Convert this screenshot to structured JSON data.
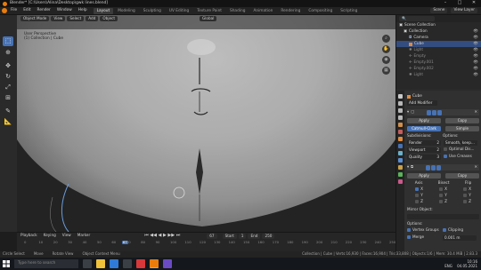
{
  "window": {
    "title": "Blender* [C:\\Users\\Alina\\Desktop\\gwk lines.blend]"
  },
  "menu": {
    "items": [
      "File",
      "Edit",
      "Render",
      "Window",
      "Help"
    ],
    "tabs": [
      "Layout",
      "Modeling",
      "Sculpting",
      "UV Editing",
      "Texture Paint",
      "Shading",
      "Animation",
      "Rendering",
      "Compositing",
      "Scripting"
    ],
    "active_tab": "Layout",
    "scene": "Scene",
    "view_layer": "View Layer"
  },
  "viewport": {
    "mode": "Object Mode",
    "menus": [
      "View",
      "Select",
      "Add",
      "Object"
    ],
    "transform": "Global",
    "info_line1": "User Perspective",
    "info_line2": "(1) Collection | Cube"
  },
  "timeline": {
    "menus": [
      "Playback",
      "Keying",
      "View",
      "Marker"
    ],
    "current_frame": "67",
    "start_label": "Start",
    "start": "1",
    "end_label": "End",
    "end": "250",
    "ticks": [
      "0",
      "10",
      "20",
      "30",
      "40",
      "50",
      "60",
      "70",
      "80",
      "90",
      "100",
      "110",
      "120",
      "130",
      "140",
      "150",
      "160",
      "170",
      "180",
      "190",
      "200",
      "210",
      "220",
      "230",
      "240",
      "250"
    ]
  },
  "outliner": {
    "header": "Scene Collection",
    "items": [
      {
        "label": "Collection",
        "selected": false
      },
      {
        "label": "Camera",
        "selected": false
      },
      {
        "label": "Cube",
        "selected": true
      },
      {
        "label": "Light",
        "selected": false
      },
      {
        "label": "Empty",
        "selected": false
      },
      {
        "label": "Empty.001",
        "selected": false
      },
      {
        "label": "Empty.002",
        "selected": false
      },
      {
        "label": "Light",
        "selected": false
      }
    ]
  },
  "properties": {
    "object_name": "Cube",
    "modifier_field": "Add Modifier",
    "apply": "Apply",
    "copy": "Copy",
    "catmull_clark": "Catmull-Clark",
    "simple": "Simple",
    "subdivisions_label": "Subdivisions:",
    "render_label": "Render",
    "render_value": "2",
    "viewport_label": "Viewport",
    "viewport_value": "2",
    "quality_label": "Quality",
    "quality_value": "3",
    "options_label": "Options:",
    "smooth_uvs": "Smooth, keep...",
    "optimal_display": "Optimal Dis...",
    "use_creases": "Use Creases",
    "mirror_apply": "Apply",
    "axis_label": "Axis",
    "bisect_label": "Bisect",
    "flip_label": "Flip",
    "axis_x": "X",
    "axis_y": "Y",
    "axis_z": "Z",
    "mirror_object_label": "Mirror Object:",
    "options2_label": "Options:",
    "vertex_groups": "Vertex Groups",
    "clipping": "Clipping",
    "merge": "Merge",
    "merge_value": "0.001 m"
  },
  "status": {
    "items": [
      "Circle Select",
      "Move",
      "Rotate View",
      "Object Context Menu"
    ],
    "right": "Collection | Cube | Verts:16,930 | Faces:16,904 | Tris:33,808 | Objects:1/6 | Mem: 30.4 MiB | 2.83.3"
  },
  "taskbar": {
    "search_placeholder": "Type here to search",
    "time": "10:16",
    "date": "04.05.2021",
    "lang": "ENG"
  },
  "colors": {
    "accent": "#4772b3",
    "orange": "#e87d0d",
    "bg": "#2a2a2a"
  }
}
